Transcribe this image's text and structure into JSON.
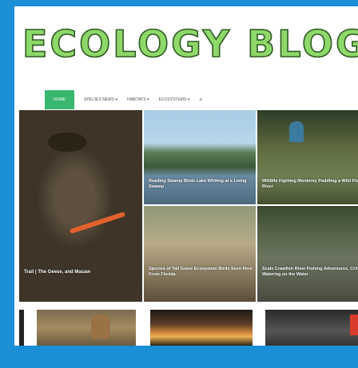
{
  "site": {
    "title": "ECOLOGY BLOG"
  },
  "nav": {
    "home": "HOME",
    "items": [
      "SPECIES NEWS ▾",
      "HABITATS ▾",
      "ECOSYSTEMS ▾"
    ]
  },
  "featured": [
    {
      "caption": "Trail | The Geese, and Macaw"
    },
    {
      "caption": "Reading Swamp Birds Lake Whiting at a Living Swamp"
    },
    {
      "caption": "Wildlife Fighting Monterey Paddling a Wild Florida River"
    },
    {
      "caption": "Species of Tall Grass Ecosystem Birds Seen Here From Florida"
    },
    {
      "caption": "Scale Crawfish River Fishing Adventures, Critter & Watering on the Water"
    }
  ],
  "colors": {
    "frame": "#1a8fd6",
    "logo": "#8ed86a",
    "accent": "#39b66f"
  }
}
